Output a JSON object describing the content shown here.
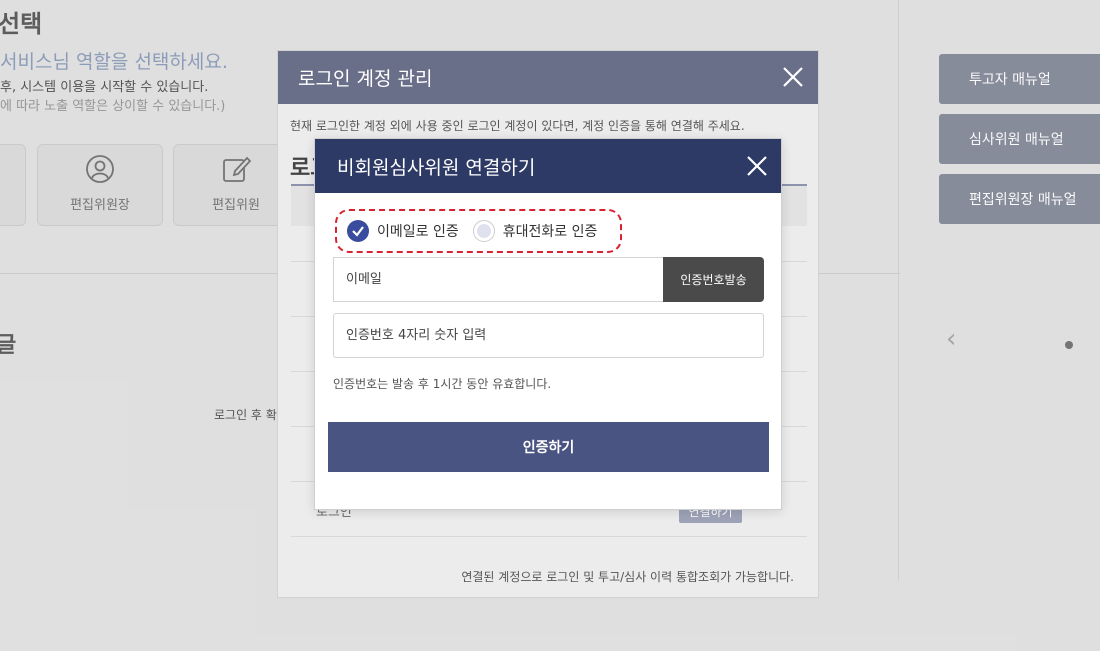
{
  "background": {
    "title": "선택",
    "subtitle": "서비스님 역할을 선택하세요.",
    "desc1": "후, 시스템 이용을 시작할 수 있습니다.",
    "desc2": "에 따라 노출 역할은 상이할 수 있습니다.)",
    "roles": [
      {
        "label": "편집위원장",
        "icon": "user-circle-icon"
      },
      {
        "label": "편집위원",
        "icon": "edit-icon"
      }
    ],
    "section_title": "글",
    "login_note": "로그인 후 확",
    "manuals": [
      "투고자 매뉴얼",
      "심사위원 매뉴얼",
      "편집위원장 매뉴얼"
    ]
  },
  "outer_modal": {
    "title": "로그인 계정 관리",
    "info": "현재 로그인한 계정 외에 사용 중인 로그인 계정이 있다면, 계정 인증을 통해 연결해 주세요.",
    "section_title": "로그",
    "row_logo": "로그인",
    "row_button": "연결하기",
    "footer": "연결된 계정으로 로그인 및 투고/심사 이력 통합조회가 가능합니다."
  },
  "inner_modal": {
    "title": "비회원심사위원 연결하기",
    "methods": [
      {
        "label": "이메일로 인증",
        "checked": true
      },
      {
        "label": "휴대전화로 인증",
        "checked": false
      }
    ],
    "email_placeholder": "이메일",
    "send_button": "인증번호발송",
    "code_placeholder": "인증번호 4자리 숫자 입력",
    "valid_note": "인증번호는 발송 후 1시간 동안 유효합니다.",
    "verify_button": "인증하기"
  },
  "colors": {
    "outer_header": "#6a6f89",
    "inner_header": "#2e3a66",
    "verify": "#4a5483",
    "highlight": "#d92231"
  }
}
